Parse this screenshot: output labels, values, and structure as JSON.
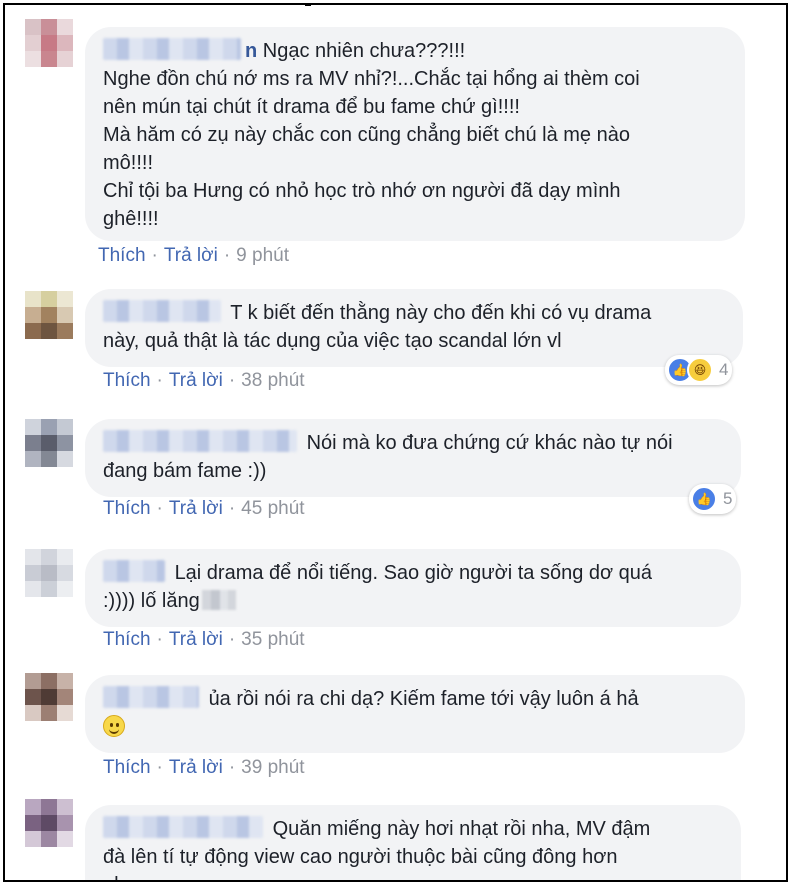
{
  "colors": {
    "link": "#4267b2",
    "bubble": "#f2f3f5",
    "meta": "#90949c",
    "name": "#365899"
  },
  "comments": [
    {
      "name_visible": "n",
      "lines": [
        "Ngạc nhiên chưa???!!!",
        "Nghe đồn chú nớ ms ra MV nhỉ?!...Chắc tại hổng ai thèm coi",
        "nên mún tại chút ít drama để bu fame chứ gì!!!!",
        "Mà hăm có zụ này chắc con cũng chẳng biết chú là mẹ nào",
        "mô!!!!",
        "Chỉ tội ba Hưng có nhỏ học trò nhớ ơn người đã dạy mình",
        "ghê!!!!"
      ],
      "like": "Thích",
      "reply": "Trả lời",
      "time": "9 phút"
    },
    {
      "lines": [
        "T k biết đến thằng này cho đến khi có vụ drama",
        "này, quả thật là tác dụng của việc tạo scandal lớn vl"
      ],
      "like": "Thích",
      "reply": "Trả lời",
      "time": "38 phút",
      "reactions": {
        "icons": [
          "like-icon",
          "haha-icon"
        ],
        "count": "4"
      }
    },
    {
      "lines": [
        "Nói mà ko đưa chứng cứ khác nào tự nói",
        "đang bám fame :))"
      ],
      "like": "Thích",
      "reply": "Trả lời",
      "time": "45 phút",
      "reactions": {
        "icons": [
          "like-icon"
        ],
        "count": "5"
      }
    },
    {
      "lines": [
        "Lại drama để nổi tiếng. Sao giờ người ta sống dơ quá",
        ":)))) lố lăng"
      ],
      "like": "Thích",
      "reply": "Trả lời",
      "time": "35 phút"
    },
    {
      "lines": [
        "ủa rồi nói ra chi dạ? Kiếm fame tới vậy luôn á hả"
      ],
      "emoji": "slightly-smiling-face-icon",
      "like": "Thích",
      "reply": "Trả lời",
      "time": "39 phút"
    },
    {
      "lines": [
        "Quăn miếng này hơi nhạt rồi nha, MV đậm",
        "đà lên tí tự động view cao người thuộc bài cũng đông hơn",
        "nha."
      ]
    }
  ]
}
